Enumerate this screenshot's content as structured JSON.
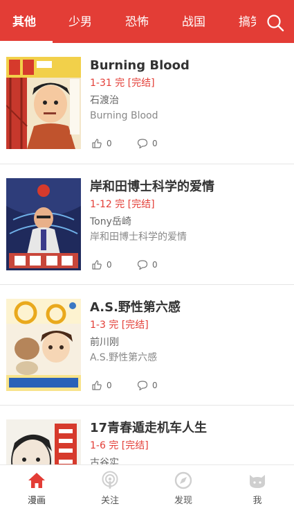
{
  "tabs": [
    "其他",
    "少男",
    "恐怖",
    "战国",
    "搞笑"
  ],
  "active_tab": "其他",
  "colors": {
    "primary": "#e33d36",
    "inactive_icon": "#cfcfcf"
  },
  "comics": [
    {
      "title": "Burning Blood",
      "status": "1-31 完 [完结]",
      "author": "石渡治",
      "desc": "Burning Blood",
      "likes": "0",
      "comments": "0",
      "cover_icon": "cover-burning-blood"
    },
    {
      "title": "岸和田博士科学的爱情",
      "status": "1-12 完 [完结]",
      "author": "Tony岳崎",
      "desc": "岸和田博士科学的爱情",
      "likes": "0",
      "comments": "0",
      "cover_icon": "cover-kishiwada"
    },
    {
      "title": "A.S.野性第六感",
      "status": "1-3 完 [完结]",
      "author": "前川刚",
      "desc": "A.S.野性第六感",
      "likes": "0",
      "comments": "0",
      "cover_icon": "cover-as"
    },
    {
      "title": "17青春遁走机车人生",
      "status": "1-6 完 [完结]",
      "author": "古谷实",
      "desc": "",
      "likes": "",
      "comments": "",
      "cover_icon": "cover-17"
    }
  ],
  "bottom_nav": [
    {
      "label": "漫画",
      "icon": "home-icon"
    },
    {
      "label": "关注",
      "icon": "podcast-icon"
    },
    {
      "label": "发现",
      "icon": "compass-icon"
    },
    {
      "label": "我",
      "icon": "cat-face-icon"
    }
  ],
  "active_nav": "漫画"
}
